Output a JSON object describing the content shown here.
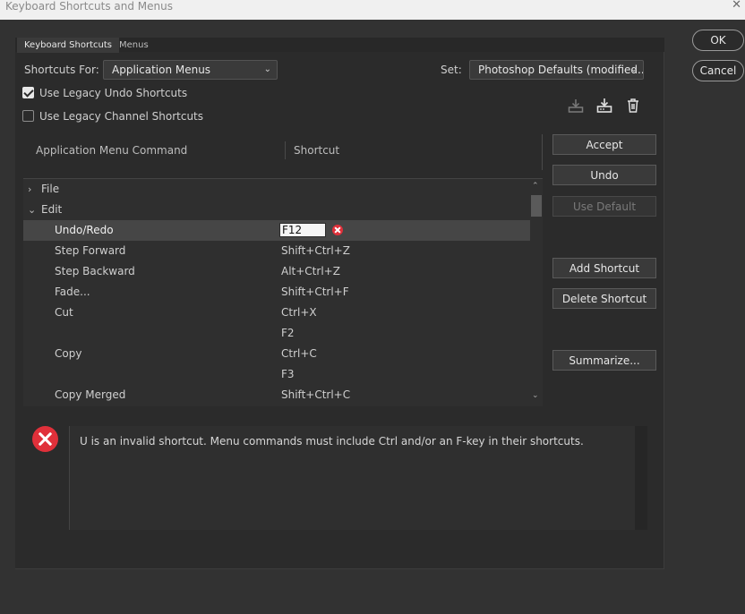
{
  "window": {
    "title": "Keyboard Shortcuts and Menus",
    "close_glyph": "✕"
  },
  "tabs": [
    {
      "label": "Keyboard Shortcuts",
      "active": true
    },
    {
      "label": "Menus",
      "active": false
    }
  ],
  "shortcuts_for": {
    "label": "Shortcuts For:",
    "value": "Application Menus"
  },
  "set": {
    "label": "Set:",
    "value": "Photoshop Defaults (modified..."
  },
  "options": {
    "legacy_undo": {
      "label": "Use Legacy Undo Shortcuts",
      "checked": true
    },
    "legacy_channel": {
      "label": "Use Legacy Channel Shortcuts",
      "checked": false
    }
  },
  "icons": [
    "save-set-icon",
    "save-set-as-icon",
    "delete-set-icon"
  ],
  "columns": {
    "command": "Application Menu Command",
    "shortcut": "Shortcut"
  },
  "rows": [
    {
      "type": "group",
      "label": "File",
      "expanded": false
    },
    {
      "type": "group",
      "label": "Edit",
      "expanded": true
    },
    {
      "type": "item",
      "command": "Undo/Redo",
      "shortcut": "F12",
      "selected": true,
      "editing": true,
      "error": true
    },
    {
      "type": "item",
      "command": "Step Forward",
      "shortcut": "Shift+Ctrl+Z"
    },
    {
      "type": "item",
      "command": "Step Backward",
      "shortcut": "Alt+Ctrl+Z"
    },
    {
      "type": "item",
      "command": "Fade...",
      "shortcut": "Shift+Ctrl+F"
    },
    {
      "type": "item",
      "command": "Cut",
      "shortcut": "Ctrl+X"
    },
    {
      "type": "item",
      "command": "",
      "shortcut": "F2"
    },
    {
      "type": "item",
      "command": "Copy",
      "shortcut": "Ctrl+C"
    },
    {
      "type": "item",
      "command": "",
      "shortcut": "F3"
    },
    {
      "type": "item",
      "command": "Copy Merged",
      "shortcut": "Shift+Ctrl+C"
    }
  ],
  "side_buttons": {
    "accept": "Accept",
    "undo": "Undo",
    "use_default": "Use Default",
    "add_shortcut": "Add Shortcut",
    "delete_shortcut": "Delete Shortcut",
    "summarize": "Summarize..."
  },
  "dialog_buttons": {
    "ok": "OK",
    "cancel": "Cancel"
  },
  "message": "U is an invalid shortcut.  Menu commands must include Ctrl and/or an F-key in their shortcuts.",
  "colors": {
    "background": "#323232",
    "panel": "#2b2b2b",
    "error": "#e0303a",
    "selection": "#464646"
  }
}
